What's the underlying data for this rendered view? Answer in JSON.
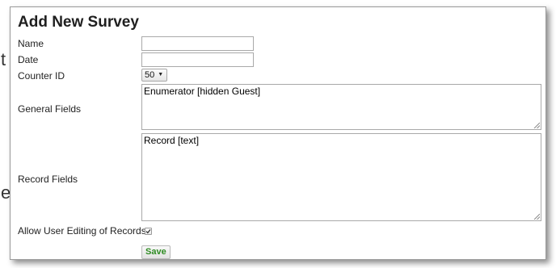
{
  "background": {
    "partial_glyph_1": "t",
    "partial_glyph_2": "e"
  },
  "dialog": {
    "title": "Add New Survey",
    "fields": {
      "name": {
        "label": "Name",
        "value": ""
      },
      "date": {
        "label": "Date",
        "value": ""
      },
      "counter_id": {
        "label": "Counter ID",
        "selected": "50"
      },
      "general_fields": {
        "label": "General Fields",
        "value": "Enumerator [hidden Guest]"
      },
      "record_fields": {
        "label": "Record Fields",
        "value": "Record [text]"
      },
      "allow_editing": {
        "label": "Allow User Editing of Records",
        "checked": true
      }
    },
    "save_label": "Save"
  },
  "colors": {
    "save_text": "#2e8b22",
    "border": "#a9a9a9"
  }
}
